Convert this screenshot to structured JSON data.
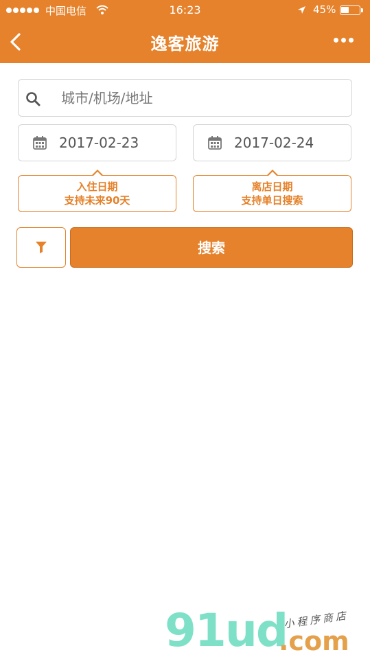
{
  "status_bar": {
    "carrier": "中国电信",
    "time": "16:23",
    "battery_percent": "45%",
    "battery_level": 0.45
  },
  "nav": {
    "title": "逸客旅游",
    "back_icon": "chevron-left-icon",
    "more_icon": "more-dots-icon"
  },
  "search": {
    "placeholder": "城市/机场/地址",
    "value": ""
  },
  "dates": {
    "checkin": "2017-02-23",
    "checkout": "2017-02-24"
  },
  "tips": {
    "checkin_line1": "入住日期",
    "checkin_line2": "支持未来90天",
    "checkout_line1": "离店日期",
    "checkout_line2": "支持单日搜索"
  },
  "actions": {
    "search_label": "搜索",
    "filter_icon": "filter-icon"
  },
  "watermark": {
    "logo": "91ud",
    "domain": ".com",
    "tagline": "小程序商店"
  },
  "colors": {
    "accent": "#E5822B",
    "border": "#d4d4d4"
  }
}
